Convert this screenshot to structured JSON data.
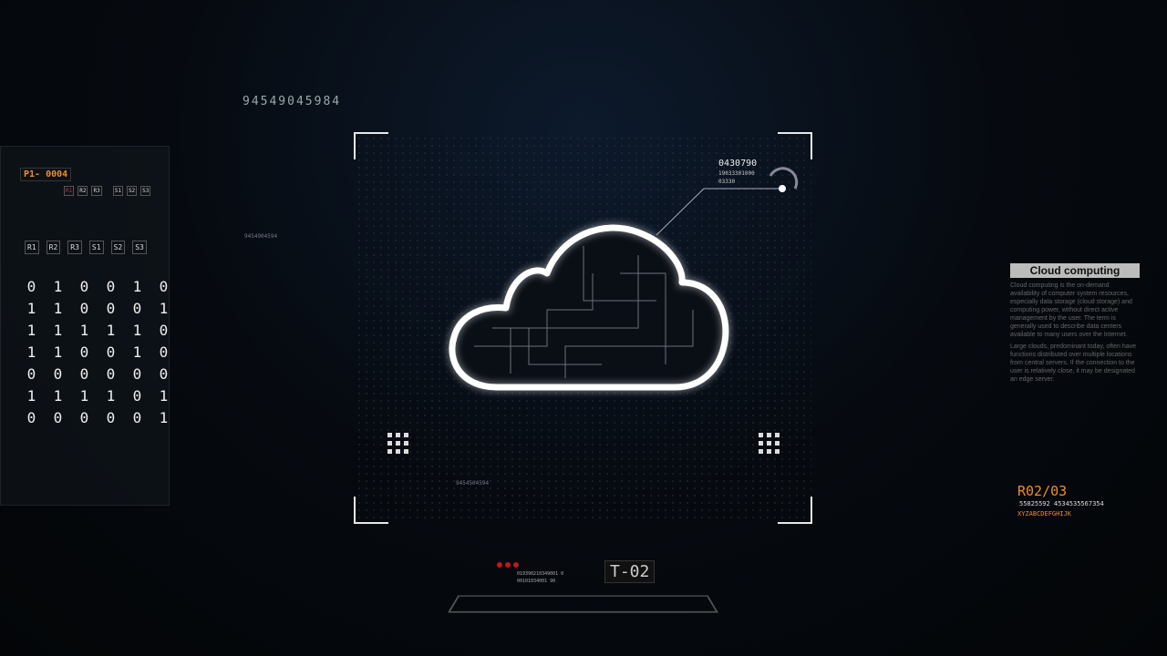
{
  "hud": {
    "top_code": "94549045984",
    "side_code": "9454904594",
    "bottom_code": "9454504594",
    "readout": {
      "main": "0430790",
      "line2": "19033301000",
      "line3": "03330"
    },
    "id_badge": "P1- 0004",
    "buttons_row1": [
      "R1",
      "R2",
      "R3",
      "S1",
      "S2",
      "S3"
    ],
    "buttons_row2": [
      "R1",
      "R2",
      "R3",
      "S1",
      "S2",
      "S3"
    ],
    "binary_grid": [
      [
        "0",
        "1",
        "0",
        "0",
        "1",
        "0"
      ],
      [
        "1",
        "1",
        "0",
        "0",
        "0",
        "1"
      ],
      [
        "1",
        "1",
        "1",
        "1",
        "1",
        "0"
      ],
      [
        "1",
        "1",
        "0",
        "0",
        "1",
        "0"
      ],
      [
        "0",
        "0",
        "0",
        "0",
        "0",
        "0"
      ],
      [
        "1",
        "1",
        "1",
        "1",
        "0",
        "1"
      ],
      [
        "0",
        "0",
        "0",
        "0",
        "0",
        "1"
      ]
    ],
    "info_panel": {
      "title": "Cloud computing",
      "para1": "Cloud computing is the on-demand availability of computer system resources, especially data storage (cloud storage) and computing power, without direct active management by the user. The term is generally used to describe data centers available to many users over the Internet.",
      "para2": "Large clouds, predominant today, often have functions distributed over multiple locations from central servers. If the connection to the user is relatively close, it may be designated an edge server."
    },
    "sector": {
      "label": "R02/03",
      "codes": "55825592  4534535567354",
      "letters": "XYZABCDEFGHIJK"
    },
    "bottom_panel": {
      "line1": "019390210349001 0",
      "line2": "00101034001 90",
      "tag": "T-02"
    },
    "colors": {
      "accent": "#f08c2a",
      "cloud": "#ffffff",
      "background": "#05080d",
      "alert": "#c01818"
    },
    "center_icon": "cloud-icon"
  }
}
